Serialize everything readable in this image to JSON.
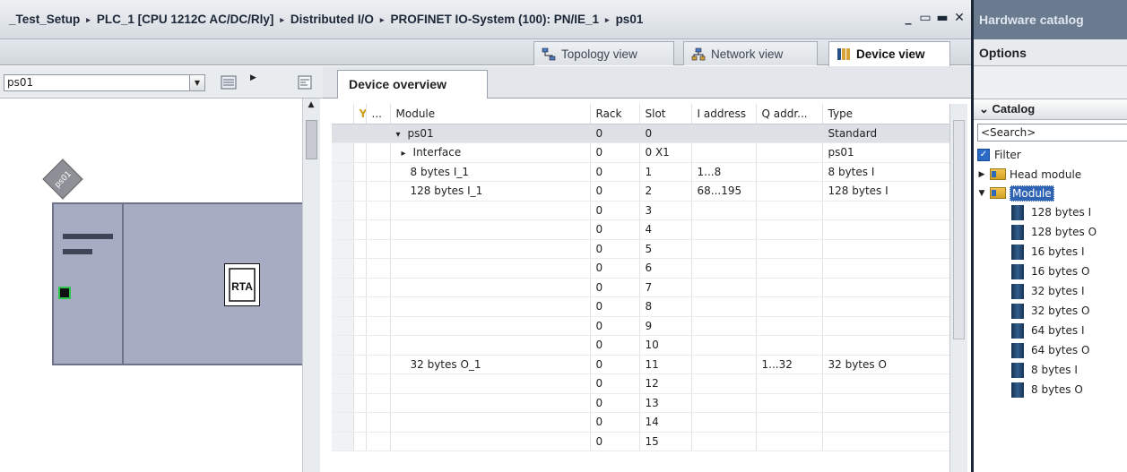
{
  "title": {
    "crumbs": [
      "_Test_Setup",
      "PLC_1 [CPU 1212C AC/DC/Rly]",
      "Distributed I/O",
      "PROFINET IO-System (100): PN/IE_1",
      "ps01"
    ],
    "separator": "▸",
    "window_buttons": [
      "_",
      "▭",
      "▬",
      "✕"
    ]
  },
  "view_tabs": [
    {
      "label": "Topology view",
      "active": false
    },
    {
      "label": "Network view",
      "active": false
    },
    {
      "label": "Device view",
      "active": true
    }
  ],
  "left_toolbar": {
    "device_select": "ps01"
  },
  "canvas": {
    "device_label": "ps01"
  },
  "device_overview": {
    "tab_label": "Device overview",
    "columns": [
      "",
      "",
      "Module",
      "Rack",
      "Slot",
      "I address",
      "Q addr...",
      "Type"
    ],
    "rows": [
      {
        "expand": "▾",
        "module": "ps01",
        "rack": "0",
        "slot": "0",
        "i": "",
        "q": "",
        "type": "Standard",
        "selected": true,
        "level": 0
      },
      {
        "expand": "▸",
        "module": "Interface",
        "rack": "0",
        "slot": "0 X1",
        "i": "",
        "q": "",
        "type": "ps01",
        "selected": false,
        "level": 1
      },
      {
        "expand": "",
        "module": "8 bytes I_1",
        "rack": "0",
        "slot": "1",
        "i": "1...8",
        "q": "",
        "type": "8 bytes I",
        "selected": false,
        "level": 2
      },
      {
        "expand": "",
        "module": "128 bytes I_1",
        "rack": "0",
        "slot": "2",
        "i": "68...195",
        "q": "",
        "type": "128 bytes I",
        "selected": false,
        "level": 2
      },
      {
        "expand": "",
        "module": "",
        "rack": "0",
        "slot": "3",
        "i": "",
        "q": "",
        "type": "",
        "selected": false,
        "level": 2
      },
      {
        "expand": "",
        "module": "",
        "rack": "0",
        "slot": "4",
        "i": "",
        "q": "",
        "type": "",
        "selected": false,
        "level": 2
      },
      {
        "expand": "",
        "module": "",
        "rack": "0",
        "slot": "5",
        "i": "",
        "q": "",
        "type": "",
        "selected": false,
        "level": 2
      },
      {
        "expand": "",
        "module": "",
        "rack": "0",
        "slot": "6",
        "i": "",
        "q": "",
        "type": "",
        "selected": false,
        "level": 2
      },
      {
        "expand": "",
        "module": "",
        "rack": "0",
        "slot": "7",
        "i": "",
        "q": "",
        "type": "",
        "selected": false,
        "level": 2
      },
      {
        "expand": "",
        "module": "",
        "rack": "0",
        "slot": "8",
        "i": "",
        "q": "",
        "type": "",
        "selected": false,
        "level": 2
      },
      {
        "expand": "",
        "module": "",
        "rack": "0",
        "slot": "9",
        "i": "",
        "q": "",
        "type": "",
        "selected": false,
        "level": 2
      },
      {
        "expand": "",
        "module": "",
        "rack": "0",
        "slot": "10",
        "i": "",
        "q": "",
        "type": "",
        "selected": false,
        "level": 2
      },
      {
        "expand": "",
        "module": "32 bytes O_1",
        "rack": "0",
        "slot": "11",
        "i": "",
        "q": "1...32",
        "type": "32 bytes O",
        "selected": false,
        "level": 2
      },
      {
        "expand": "",
        "module": "",
        "rack": "0",
        "slot": "12",
        "i": "",
        "q": "",
        "type": "",
        "selected": false,
        "level": 2
      },
      {
        "expand": "",
        "module": "",
        "rack": "0",
        "slot": "13",
        "i": "",
        "q": "",
        "type": "",
        "selected": false,
        "level": 2
      },
      {
        "expand": "",
        "module": "",
        "rack": "0",
        "slot": "14",
        "i": "",
        "q": "",
        "type": "",
        "selected": false,
        "level": 2
      },
      {
        "expand": "",
        "module": "",
        "rack": "0",
        "slot": "15",
        "i": "",
        "q": "",
        "type": "",
        "selected": false,
        "level": 2
      }
    ]
  },
  "catalog": {
    "pane_title": "Hardware catalog",
    "options_label": "Options",
    "section_label": "Catalog",
    "search_placeholder": "<Search>",
    "filter_label": "Filter",
    "folders": [
      {
        "label": "Head module",
        "expanded": false,
        "highlighted": false
      },
      {
        "label": "Module",
        "expanded": true,
        "highlighted": true
      }
    ],
    "modules": [
      "128 bytes I",
      "128 bytes O",
      "16 bytes I",
      "16 bytes O",
      "32 bytes I",
      "32 bytes O",
      "64 bytes I",
      "64 bytes O",
      "8 bytes I",
      "8 bytes O"
    ]
  }
}
